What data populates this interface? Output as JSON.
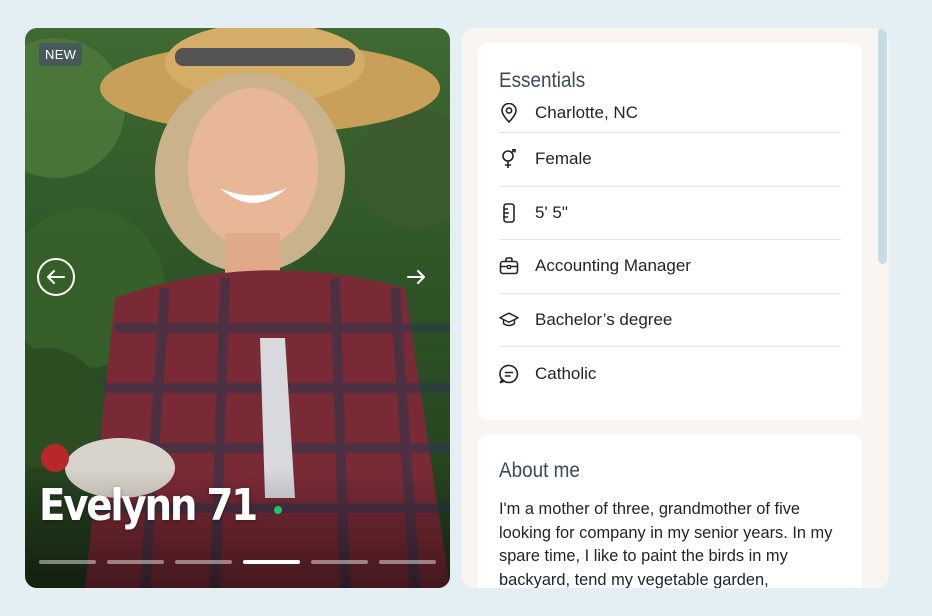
{
  "photo": {
    "badge": "NEW",
    "name_age": "Evelynn 71",
    "online": true,
    "photo_count": 6,
    "active_photo_index": 3
  },
  "essentials": {
    "title": "Essentials",
    "items": [
      {
        "icon": "location-pin-icon",
        "label": "Charlotte, NC"
      },
      {
        "icon": "gender-female-icon",
        "label": "Female"
      },
      {
        "icon": "ruler-icon",
        "label": "5' 5\""
      },
      {
        "icon": "briefcase-icon",
        "label": "Accounting Manager"
      },
      {
        "icon": "graduation-cap-icon",
        "label": "Bachelor’s degree"
      },
      {
        "icon": "religion-chat-icon",
        "label": "Catholic"
      }
    ]
  },
  "about": {
    "title": "About me",
    "text": "I'm a mother of three, grandmother of five looking for company in my senior years. In my spare time, I like to paint the birds in my backyard, tend my vegetable garden,"
  },
  "colors": {
    "page_bg": "#e4eff3",
    "panel_bg": "#f8f5f3",
    "online": "#1ec46b",
    "heading": "#3b4a57"
  }
}
